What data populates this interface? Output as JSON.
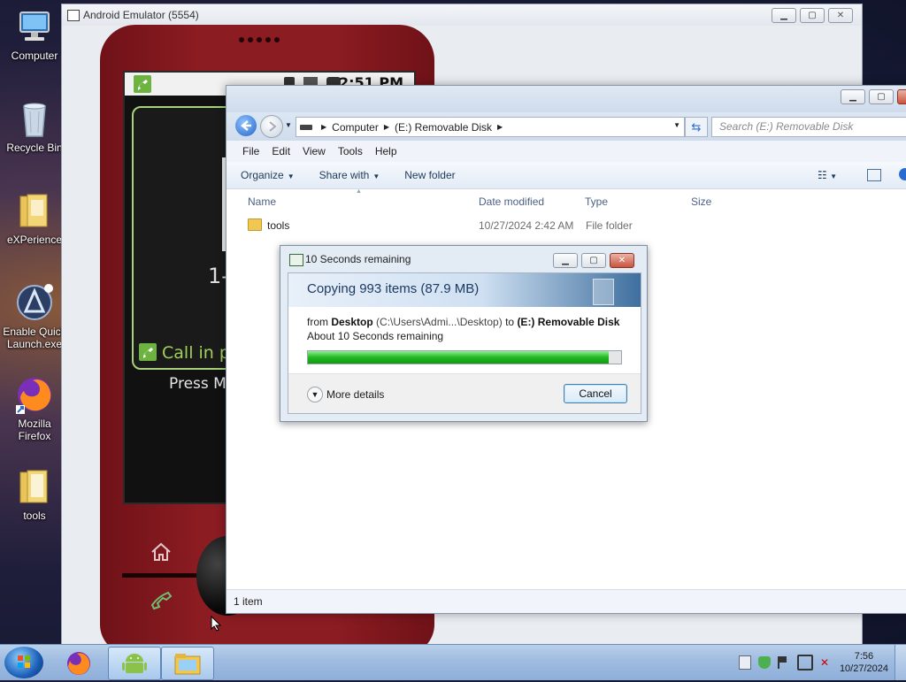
{
  "desktop": {
    "icons": [
      {
        "label": "Computer"
      },
      {
        "label": "Recycle Bin"
      },
      {
        "label": "eXPerience"
      },
      {
        "label": "Enable Quick Launch.exe"
      },
      {
        "label": "Mozilla Firefox"
      },
      {
        "label": "tools"
      }
    ]
  },
  "emulator": {
    "title": "Android Emulator (5554)",
    "statusbar_time": "2:51 PM",
    "digits_visible": "1-",
    "call_label_visible": "Call in pr",
    "press_label_visible": "Press M"
  },
  "explorer": {
    "breadcrumb": [
      "Computer",
      "(E:) Removable Disk"
    ],
    "search_placeholder": "Search (E:) Removable Disk",
    "menu": [
      "File",
      "Edit",
      "View",
      "Tools",
      "Help"
    ],
    "toolbar": {
      "organize": "Organize",
      "share_with": "Share with",
      "new_folder": "New folder"
    },
    "columns": {
      "name": "Name",
      "date_modified": "Date modified",
      "type": "Type",
      "size": "Size"
    },
    "rows": [
      {
        "name": "tools",
        "date_modified": "10/27/2024 2:42 AM",
        "type": "File folder",
        "size": ""
      }
    ],
    "status": "1 item"
  },
  "copy_dialog": {
    "title": "10 Seconds remaining",
    "heading": "Copying 993 items (87.9 MB)",
    "from_label": "from",
    "source_name": "Desktop",
    "source_path": "(C:\\Users\\Admi...\\Desktop)",
    "to_label": "to",
    "dest_name": "(E:) Removable Disk",
    "remaining": "About 10 Seconds remaining",
    "progress_fraction": 0.96,
    "more_details": "More details",
    "cancel": "Cancel"
  },
  "taskbar": {
    "clock_time": "7:56",
    "clock_date": "10/27/2024"
  },
  "colors": {
    "phone_body": "#8b1c22",
    "progress_green": "#22b822",
    "accent_blue": "#3c7fb1"
  }
}
